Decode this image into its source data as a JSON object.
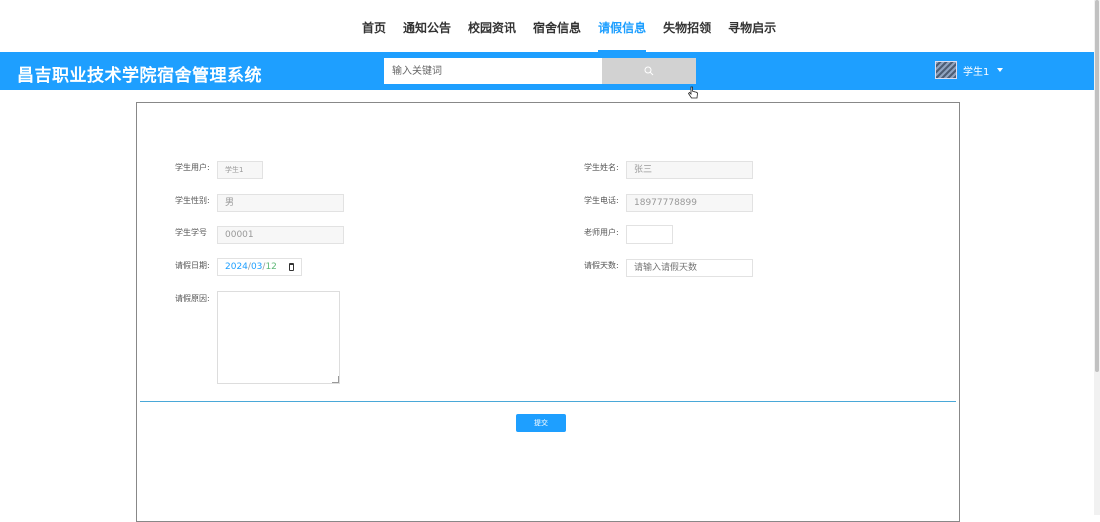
{
  "nav": {
    "items": [
      {
        "label": "首页"
      },
      {
        "label": "通知公告"
      },
      {
        "label": "校园资讯"
      },
      {
        "label": "宿舍信息"
      },
      {
        "label": "请假信息"
      },
      {
        "label": "失物招领"
      },
      {
        "label": "寻物启示"
      }
    ],
    "active_index": 4
  },
  "header": {
    "title": "昌吉职业技术学院宿舍管理系统",
    "search_placeholder": "输入关键词",
    "search_icon": "search-icon",
    "user_name": "学生1",
    "user_menu_icon": "caret-down-icon"
  },
  "form": {
    "student_user": {
      "label": "学生用户:",
      "value": "学生1"
    },
    "student_name": {
      "label": "学生姓名:",
      "value": "张三"
    },
    "student_gender": {
      "label": "学生性别:",
      "value": "男"
    },
    "student_phone": {
      "label": "学生电话:",
      "value": "18977778899"
    },
    "student_id": {
      "label": "学生学号",
      "value": "00001"
    },
    "teacher_user": {
      "label": "老师用户:",
      "value": ""
    },
    "leave_date": {
      "label": "请假日期:",
      "year": "2024",
      "month": "03",
      "day": "12",
      "sep": "/"
    },
    "leave_days": {
      "label": "请假天数:",
      "placeholder": "请输入请假天数"
    },
    "leave_reason": {
      "label": "请假原因:",
      "value": ""
    },
    "submit_label": "提交"
  },
  "colors": {
    "primary": "#1E9FFF",
    "header_bg": "#1E9FFF",
    "divider": "#4aa8d8"
  }
}
